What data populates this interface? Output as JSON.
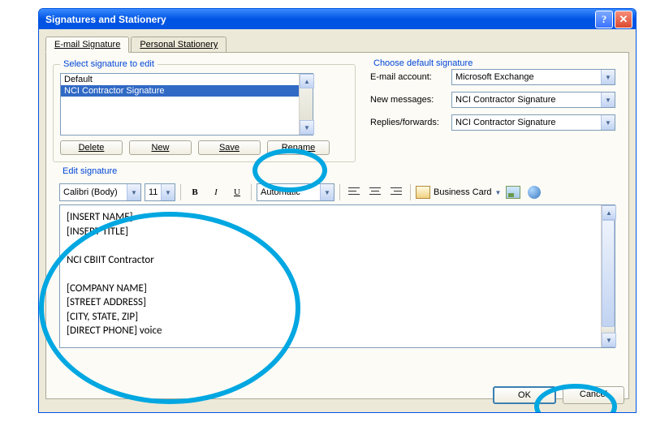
{
  "dialog": {
    "title": "Signatures and Stationery",
    "tabs": [
      {
        "label": "E-mail Signature",
        "mnemonic_index": 0,
        "active": true
      },
      {
        "label": "Personal Stationery",
        "mnemonic_index": 0,
        "active": false
      }
    ]
  },
  "select_group": {
    "legend": "Select signature to edit",
    "items": [
      {
        "label": "Default",
        "selected": false
      },
      {
        "label": "NCI Contractor Signature",
        "selected": true
      }
    ],
    "buttons": {
      "delete": "Delete",
      "new": "New",
      "save": "Save",
      "rename": "Rename"
    }
  },
  "default_group": {
    "legend": "Choose default signature",
    "rows": {
      "account": {
        "label": "E-mail account:",
        "value": "Microsoft Exchange"
      },
      "new_msg": {
        "label": "New messages:",
        "value": "NCI Contractor Signature"
      },
      "replies": {
        "label": "Replies/forwards:",
        "value": "NCI Contractor Signature"
      }
    }
  },
  "edit_group": {
    "legend": "Edit signature",
    "font": "Calibri (Body)",
    "size": "11",
    "color_label": "Automatic",
    "business_card": "Business Card",
    "content": "[INSERT NAME]\n[INSERT TITLE]\n\nNCI CBIIT Contractor\n\n[COMPANY NAME]\n[STREET ADDRESS]\n[CITY, STATE, ZIP]\n[DIRECT PHONE] voice"
  },
  "footer": {
    "ok": "OK",
    "cancel": "Cancel"
  }
}
